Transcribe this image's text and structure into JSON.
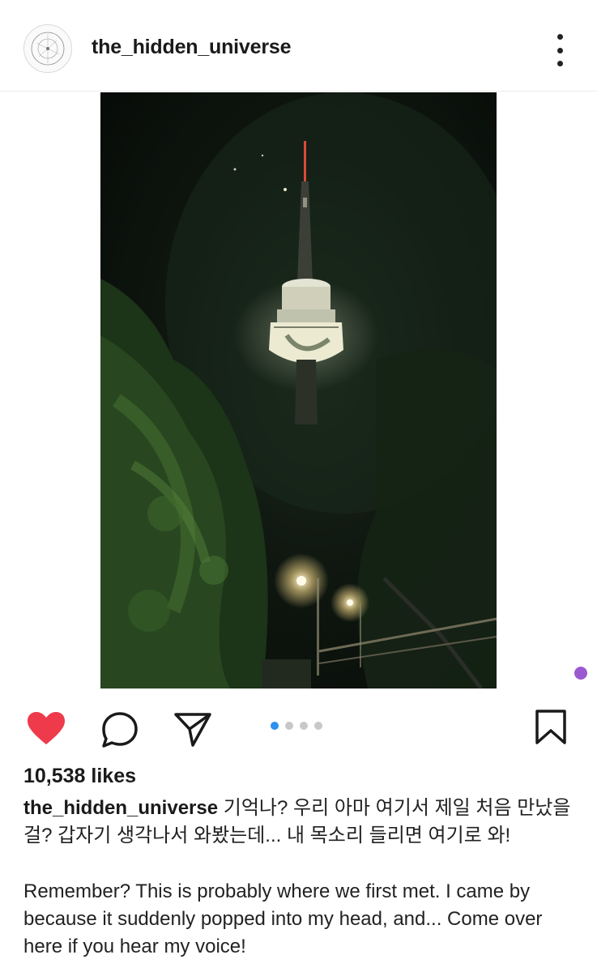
{
  "post": {
    "username": "the_hidden_universe",
    "likes_text": "10,538 likes",
    "liked": true,
    "carousel": {
      "count": 4,
      "active_index": 0
    },
    "caption_korean": "기억나? 우리 아마 여기서 제일 처음 만났을 걸? 갑자기 생각나서 와봤는데... 내 목소리 들리면 여기로 와!",
    "caption_english": "Remember? This is probably where we first met. I came by because it suddenly popped into my head, and... Come over here if you hear my voice!"
  },
  "icons": {
    "header_more": "more-vertical-icon",
    "like": "heart-icon",
    "comment": "comment-icon",
    "share": "send-icon",
    "save": "bookmark-icon"
  },
  "colors": {
    "like": "#ef3a4c",
    "carousel_active": "#2d8ff0",
    "carousel_inactive": "#c8c8c8",
    "story_dot": "#9b59d0"
  }
}
